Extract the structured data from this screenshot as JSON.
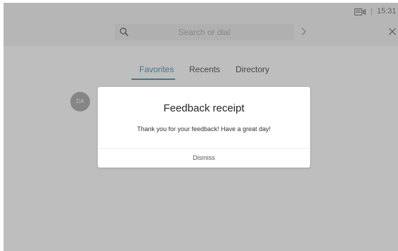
{
  "status_bar": {
    "camera_icon": "camera-icon",
    "separator": "|",
    "time": "15:31"
  },
  "search": {
    "placeholder": "Search or dial",
    "search_icon": "search-icon",
    "go_icon": "chevron-right-icon",
    "close_icon": "close-icon"
  },
  "tabs": [
    {
      "label": "Favorites",
      "active": true
    },
    {
      "label": "Recents",
      "active": false
    },
    {
      "label": "Directory",
      "active": false
    }
  ],
  "favorites": [
    {
      "initials": "DA"
    }
  ],
  "dialog": {
    "title": "Feedback receipt",
    "message": "Thank you for your feedback! Have a great day!",
    "dismiss_label": "Dismiss"
  },
  "colors": {
    "accent": "#1f7fa3",
    "overlay": "rgba(110,110,110,0.45)"
  }
}
